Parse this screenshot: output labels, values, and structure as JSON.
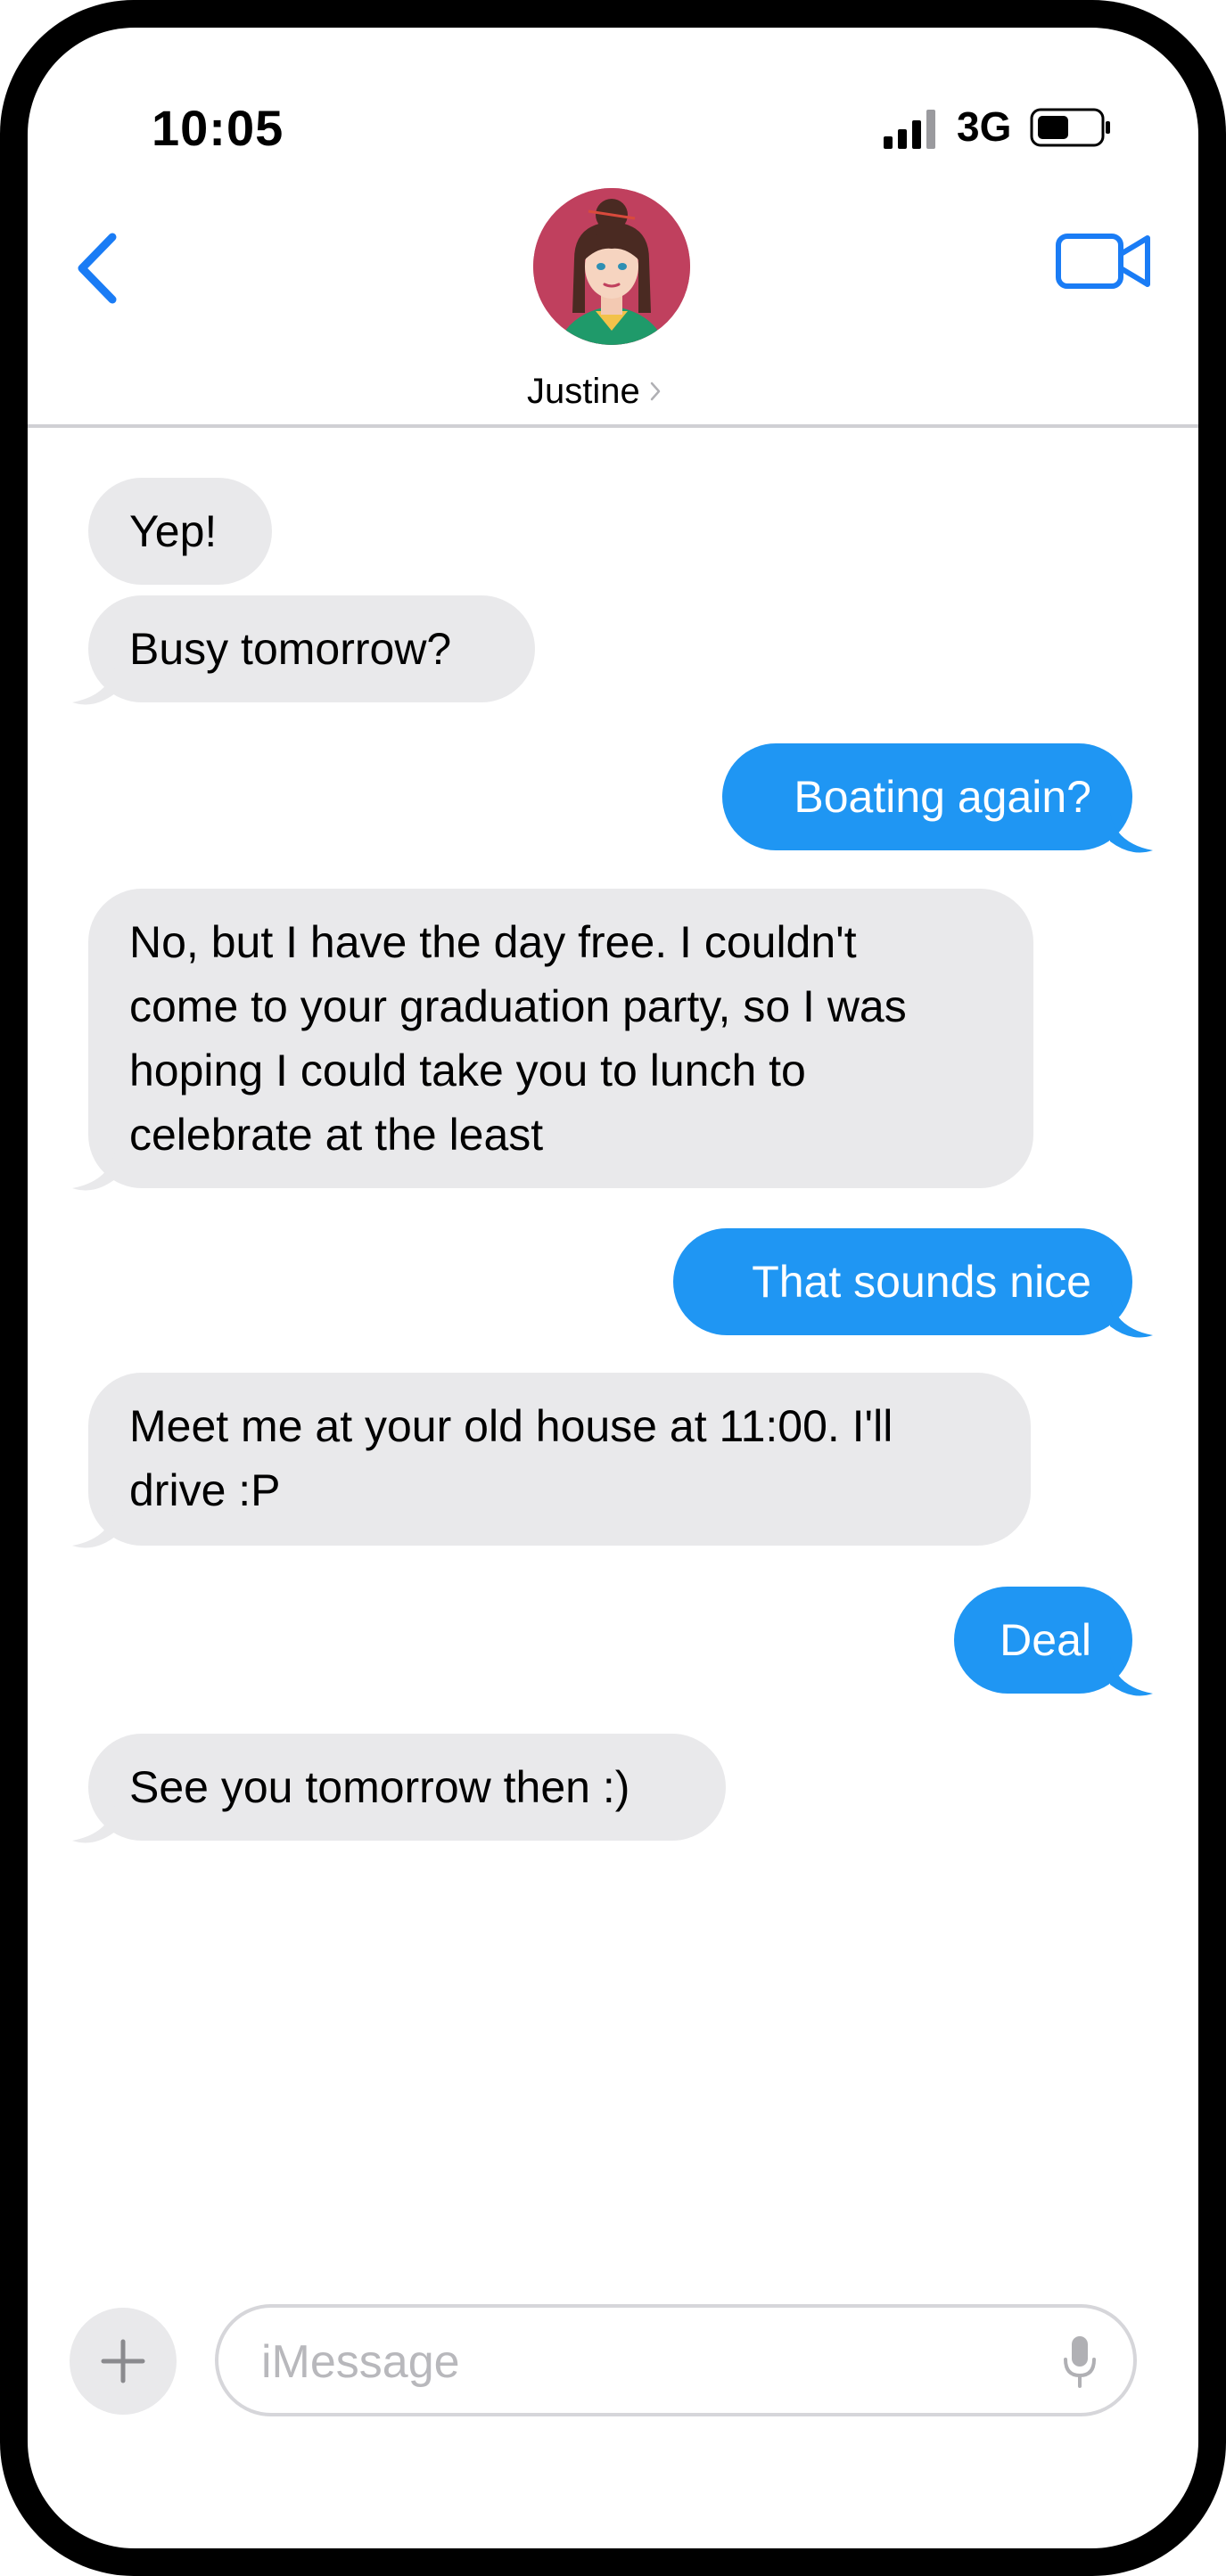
{
  "status_bar": {
    "time": "10:05",
    "network": "3G"
  },
  "header": {
    "contact_name": "Justine"
  },
  "messages": [
    {
      "direction": "received",
      "text": "Yep!"
    },
    {
      "direction": "received",
      "text": "Busy tomorrow?"
    },
    {
      "direction": "sent",
      "text": "Boating again?"
    },
    {
      "direction": "received",
      "lines": [
        "No, but I have the day free.  I couldn't",
        "come to your graduation party, so I was",
        "hoping I could take you to lunch to",
        "celebrate at the least"
      ]
    },
    {
      "direction": "sent",
      "text": "That sounds nice"
    },
    {
      "direction": "received",
      "lines": [
        "Meet me at your old house at 11:00.  I'll",
        "drive :P"
      ]
    },
    {
      "direction": "sent",
      "text": "Deal"
    },
    {
      "direction": "received",
      "text": "See you tomorrow then :)"
    }
  ],
  "input_bar": {
    "placeholder": "iMessage"
  },
  "icons": [
    "signal-icon",
    "battery-icon",
    "back-chevron-icon",
    "video-camera-icon",
    "plus-icon",
    "microphone-icon"
  ],
  "colors": {
    "accent": "#1a7cf5",
    "sent_bubble": "#1f96f3",
    "received_bubble": "#e9e9eb",
    "frame": "#000000"
  }
}
